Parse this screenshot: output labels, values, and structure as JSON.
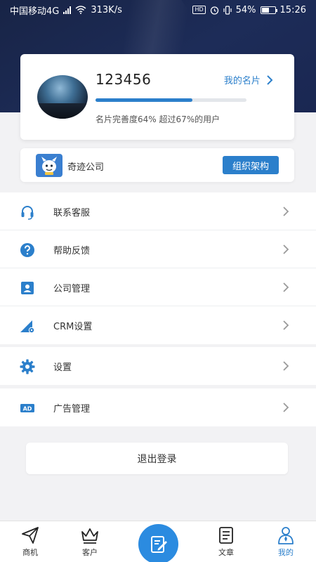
{
  "status_bar": {
    "carrier": "中国移动4G",
    "network_speed": "313K/s",
    "battery": "54%",
    "time": "15:26"
  },
  "profile": {
    "user_id": "123456",
    "card_link_label": "我的名片",
    "completion_percent": 64,
    "completion_text": "名片完善度64% 超过67%的用户"
  },
  "company": {
    "name": "奇迹公司",
    "org_button_label": "组织架构"
  },
  "menu_groups": [
    [
      {
        "label": "联系客服",
        "icon": "headset-icon"
      },
      {
        "label": "帮助反馈",
        "icon": "help-icon"
      },
      {
        "label": "公司管理",
        "icon": "contact-card-icon"
      },
      {
        "label": "CRM设置",
        "icon": "crm-settings-icon"
      }
    ],
    [
      {
        "label": "设置",
        "icon": "gear-icon"
      }
    ],
    [
      {
        "label": "广告管理",
        "icon": "ad-icon"
      }
    ]
  ],
  "logout_label": "退出登录",
  "bottom_nav": {
    "items": [
      {
        "label": "商机",
        "icon": "paper-plane-icon"
      },
      {
        "label": "客户",
        "icon": "crown-icon"
      },
      {
        "label": "",
        "icon": "compose-icon"
      },
      {
        "label": "文章",
        "icon": "article-icon"
      },
      {
        "label": "我的",
        "icon": "profile-icon"
      }
    ],
    "active": "我的"
  },
  "colors": {
    "accent": "#2b7fcb",
    "header_bg": "#1b2850",
    "page_bg": "#f2f2f4"
  }
}
